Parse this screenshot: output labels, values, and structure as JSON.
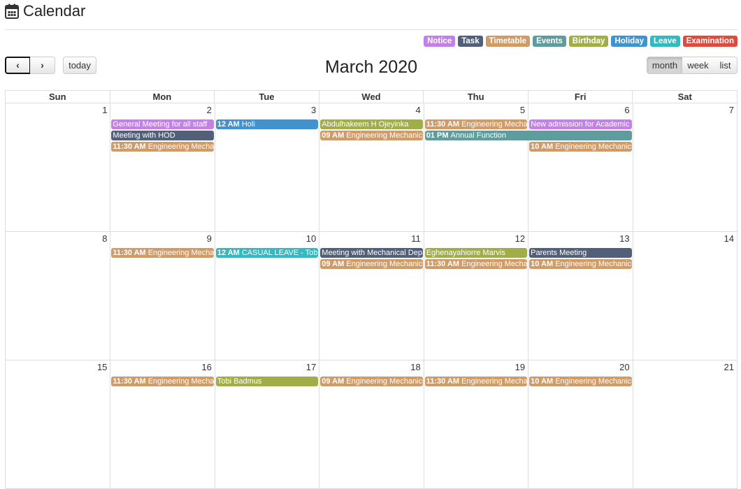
{
  "header": {
    "title": "Calendar",
    "icon": "calendar-icon"
  },
  "legend": [
    {
      "label": "Notice",
      "color": "#c381e8"
    },
    {
      "label": "Task",
      "color": "#525f78"
    },
    {
      "label": "Timetable",
      "color": "#d19b67"
    },
    {
      "label": "Events",
      "color": "#5e9c9d"
    },
    {
      "label": "Birthday",
      "color": "#a1ae47"
    },
    {
      "label": "Holiday",
      "color": "#4193d0"
    },
    {
      "label": "Leave",
      "color": "#33b9c2"
    },
    {
      "label": "Examination",
      "color": "#dc4b3e"
    }
  ],
  "toolbar": {
    "prev_icon": "‹",
    "next_icon": "›",
    "today_label": "today",
    "title": "March 2020",
    "views": [
      "month",
      "week",
      "list"
    ],
    "active_view": "month"
  },
  "weekdays": [
    "Sun",
    "Mon",
    "Tue",
    "Wed",
    "Thu",
    "Fri",
    "Sat"
  ],
  "weeks": [
    {
      "days": [
        "1",
        "2",
        "3",
        "4",
        "5",
        "6",
        "7"
      ],
      "events": [
        {
          "day": 1,
          "span": 1,
          "row": 0,
          "time": "",
          "title": "General Meeting for all staff",
          "type": "Notice"
        },
        {
          "day": 1,
          "span": 1,
          "row": 1,
          "time": "",
          "title": "Meeting with HOD",
          "type": "Task"
        },
        {
          "day": 1,
          "span": 1,
          "row": 2,
          "time": "11:30 AM",
          "title": "Engineering Mechanics",
          "type": "Timetable"
        },
        {
          "day": 2,
          "span": 1,
          "row": 0,
          "time": "12 AM",
          "title": "Holi",
          "type": "Holiday"
        },
        {
          "day": 3,
          "span": 1,
          "row": 0,
          "time": "",
          "title": "Abdulhakeem H Ojeyinka",
          "type": "Birthday"
        },
        {
          "day": 3,
          "span": 1,
          "row": 1,
          "time": "09 AM",
          "title": "Engineering Mechanics",
          "type": "Timetable"
        },
        {
          "day": 4,
          "span": 1,
          "row": 0,
          "time": "11:30 AM",
          "title": "Engineering Mechanics",
          "type": "Timetable"
        },
        {
          "day": 4,
          "span": 2,
          "row": 1,
          "time": "01 PM",
          "title": "Annual Function",
          "type": "Events"
        },
        {
          "day": 5,
          "span": 1,
          "row": 0,
          "time": "",
          "title": "New admission for Academic year",
          "type": "Notice"
        },
        {
          "day": 5,
          "span": 1,
          "row": 2,
          "time": "10 AM",
          "title": "Engineering Mechanics",
          "type": "Timetable"
        }
      ]
    },
    {
      "days": [
        "8",
        "9",
        "10",
        "11",
        "12",
        "13",
        "14"
      ],
      "events": [
        {
          "day": 1,
          "span": 1,
          "row": 0,
          "time": "11:30 AM",
          "title": "Engineering Mechanics",
          "type": "Timetable"
        },
        {
          "day": 2,
          "span": 1,
          "row": 0,
          "time": "12 AM",
          "title": "CASUAL LEAVE - Tobi",
          "type": "Leave"
        },
        {
          "day": 3,
          "span": 1,
          "row": 0,
          "time": "",
          "title": "Meeting with Mechanical Department",
          "type": "Task"
        },
        {
          "day": 3,
          "span": 1,
          "row": 1,
          "time": "09 AM",
          "title": "Engineering Mechanics",
          "type": "Timetable"
        },
        {
          "day": 4,
          "span": 1,
          "row": 0,
          "time": "",
          "title": "Eghenayahiorre Marvis",
          "type": "Birthday"
        },
        {
          "day": 4,
          "span": 1,
          "row": 1,
          "time": "11:30 AM",
          "title": "Engineering Mechanics",
          "type": "Timetable"
        },
        {
          "day": 5,
          "span": 1,
          "row": 0,
          "time": "",
          "title": "Parents Meeting",
          "type": "Task"
        },
        {
          "day": 5,
          "span": 1,
          "row": 1,
          "time": "10 AM",
          "title": "Engineering Mechanics",
          "type": "Timetable"
        }
      ]
    },
    {
      "days": [
        "15",
        "16",
        "17",
        "18",
        "19",
        "20",
        "21"
      ],
      "events": [
        {
          "day": 1,
          "span": 1,
          "row": 0,
          "time": "11:30 AM",
          "title": "Engineering Mechanics",
          "type": "Timetable"
        },
        {
          "day": 2,
          "span": 1,
          "row": 0,
          "time": "",
          "title": "Tobi Badmus",
          "type": "Birthday"
        },
        {
          "day": 3,
          "span": 1,
          "row": 0,
          "time": "09 AM",
          "title": "Engineering Mechanics",
          "type": "Timetable"
        },
        {
          "day": 4,
          "span": 1,
          "row": 0,
          "time": "11:30 AM",
          "title": "Engineering Mechanics",
          "type": "Timetable"
        },
        {
          "day": 5,
          "span": 1,
          "row": 0,
          "time": "10 AM",
          "title": "Engineering Mechanics",
          "type": "Timetable"
        }
      ]
    }
  ]
}
